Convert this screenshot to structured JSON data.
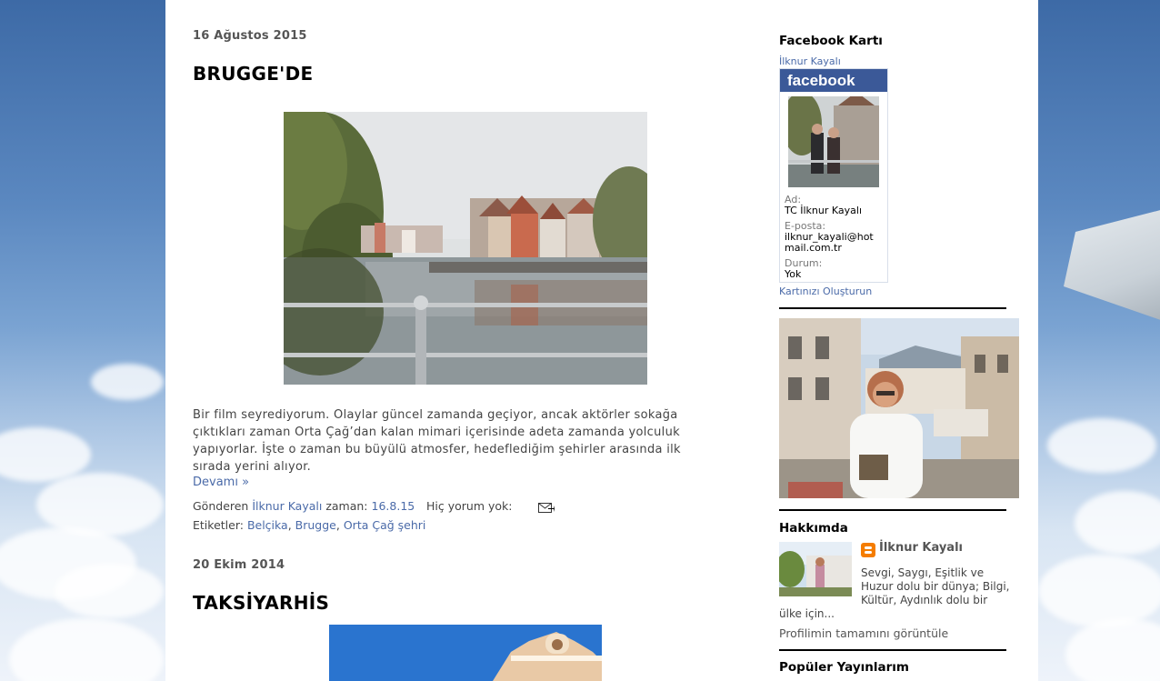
{
  "post1": {
    "date": "16 Ağustos 2015",
    "title": "BRUGGE'DE",
    "body": "Bir film seyrediyorum. Olaylar güncel zamanda geçiyor, ancak aktörler sokağa çıktıkları zaman Orta Çağ’dan kalan mimari içerisinde adeta zamanda yolculuk yapıyorlar. İşte o zaman bu büyülü atmosfer, hedeflediğim şehirler arasında ilk sırada yerini alıyor.",
    "read_more": "Devamı »",
    "posted_by_label": "Gönderen",
    "author": "İlknur Kayalı",
    "time_label": "zaman:",
    "time": "16.8.15",
    "comments": "Hiç yorum yok:",
    "labels_label": "Etiketler:",
    "labels": [
      "Belçika",
      "Brugge",
      "Orta Çağ şehri"
    ],
    "label_sep": ","
  },
  "post2": {
    "date": "20 Ekim 2014",
    "title": "TAKSİYARHİS"
  },
  "sidebar": {
    "facebook_title": "Facebook Kartı",
    "fb_name_link": "İlknur Kayalı",
    "fb_logo": "facebook",
    "fb_ad_label": "Ad:",
    "fb_ad": "TC İlknur Kayalı",
    "fb_email_label": "E-posta:",
    "fb_email_1": "ilknur_kayali@hot",
    "fb_email_2": "mail.com.tr",
    "fb_status_label": "Durum:",
    "fb_status": "Yok",
    "fb_create": "Kartınızı Oluşturun",
    "about_title": "Hakkımda",
    "about_name": "İlknur Kayalı",
    "about_text_1": "Sevgi, Saygı, Eşitlik ve",
    "about_text_2": "Huzur dolu bir dünya; Bilgi,",
    "about_text_3": "Kültür, Aydınlık dolu bir",
    "about_text_4": "ülke için...",
    "profile_link": "Profilimin tamamını görüntüle",
    "popular_title": "Popüler Yayınlarım"
  },
  "icons": {
    "email": "email-post-icon",
    "blogger": "blogger-icon"
  },
  "colors": {
    "link": "#4a6aa8",
    "facebook_blue": "#3b5998",
    "blogger_orange": "#f57d00"
  }
}
